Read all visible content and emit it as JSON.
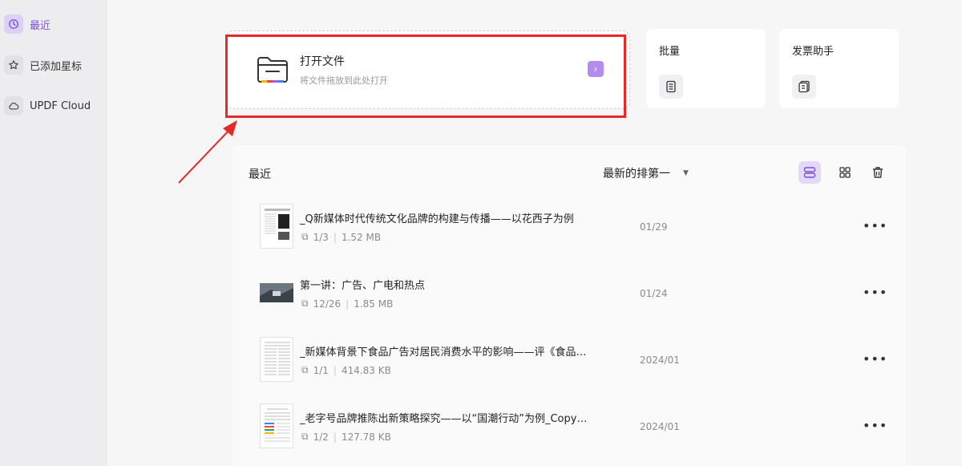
{
  "sidebar": {
    "items": [
      {
        "label": "最近",
        "icon": "clock-icon",
        "active": true
      },
      {
        "label": "已添加星标",
        "icon": "star-icon",
        "active": false
      },
      {
        "label": "UPDF Cloud",
        "icon": "cloud-icon",
        "active": false
      }
    ]
  },
  "open_file": {
    "title": "打开文件",
    "subtitle": "将文件拖放到此处打开",
    "arrow": "›"
  },
  "tools": [
    {
      "label": "批量",
      "icon": "batch-icon"
    },
    {
      "label": "发票助手",
      "icon": "invoice-icon"
    }
  ],
  "recent": {
    "title": "最近",
    "sort_label": "最新的排第一",
    "files": [
      {
        "name": "_Q新媒体时代传统文化品牌的构建与传播——以花西子为例",
        "pages": "1/3",
        "size": "1.52 MB",
        "date": "01/29"
      },
      {
        "name": "第一讲：广告、广电和热点",
        "pages": "12/26",
        "size": "1.85 MB",
        "date": "01/24"
      },
      {
        "name": "_新媒体背景下食品广告对居民消费水平的影响——评《食品广...",
        "pages": "1/1",
        "size": "414.83 KB",
        "date": "2024/01"
      },
      {
        "name": "_老字号品牌推陈出新策略探究——以“国潮行动”为例_Copy_Co...",
        "pages": "1/2",
        "size": "127.78 KB",
        "date": "2024/01"
      }
    ]
  },
  "colors": {
    "accent": "#7a4fd6",
    "highlight": "#e62a2a"
  }
}
